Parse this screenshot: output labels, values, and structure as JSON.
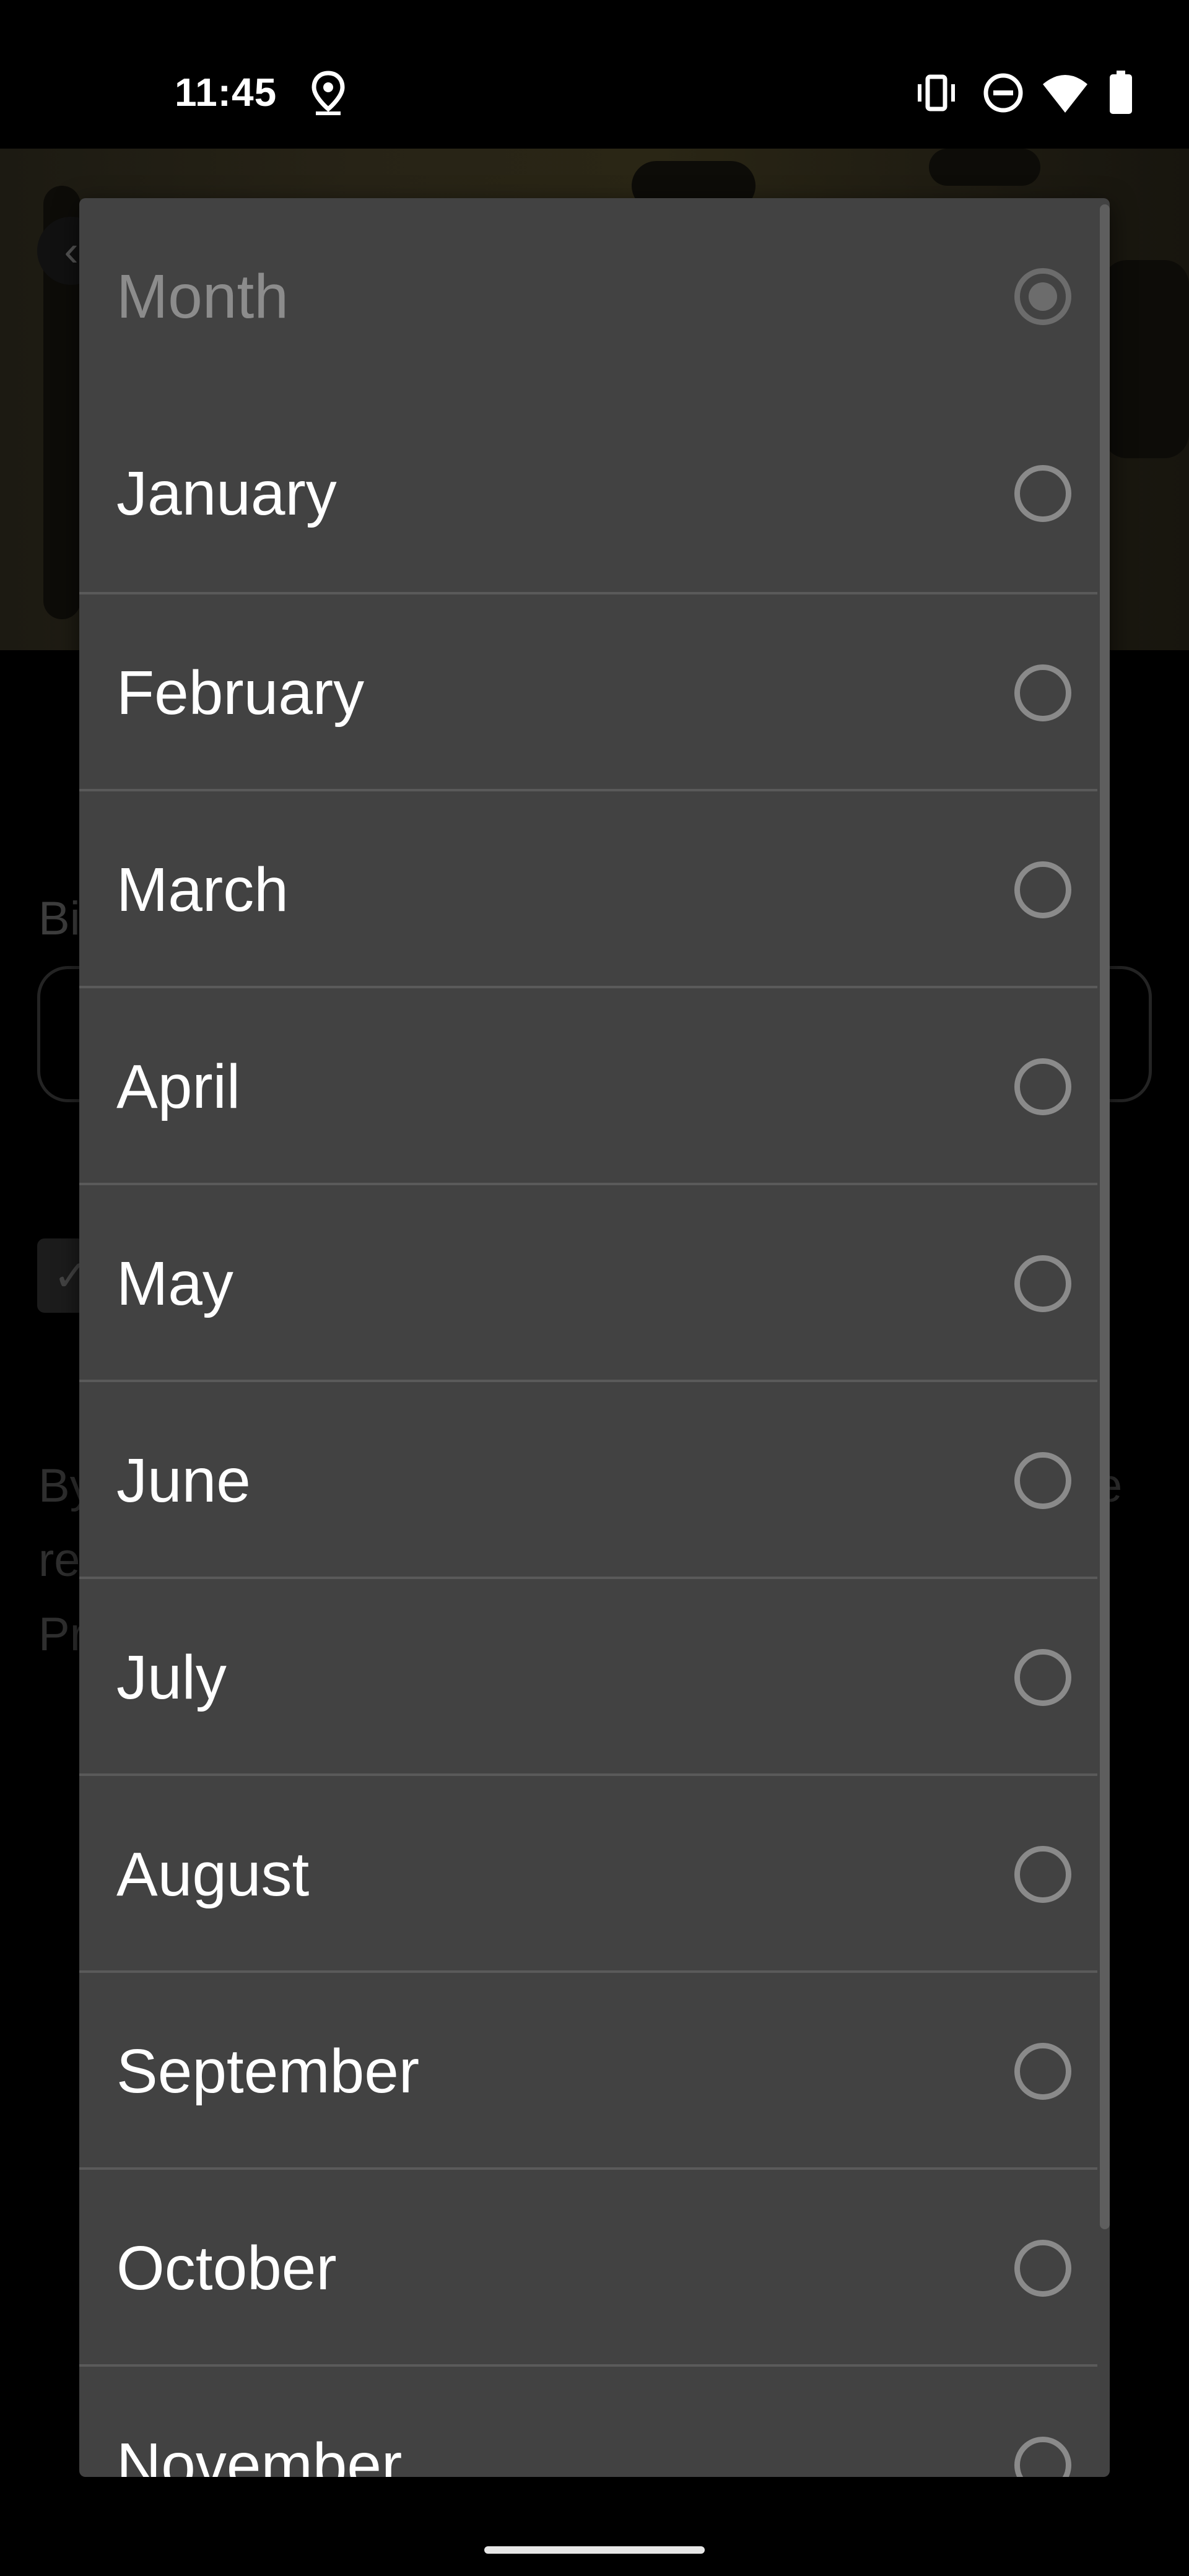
{
  "status_bar": {
    "time": "11:45",
    "icons": [
      "location-icon",
      "vibrate-icon",
      "do-not-disturb-icon",
      "wifi-icon",
      "battery-icon"
    ]
  },
  "background": {
    "field_label_fragment": "Bi",
    "terms_fragment": "By\nre\nPr",
    "terms_right_fragment": "e"
  },
  "dialog": {
    "header": {
      "label": "Month",
      "selected": true
    },
    "options": [
      {
        "label": "January"
      },
      {
        "label": "February"
      },
      {
        "label": "March"
      },
      {
        "label": "April"
      },
      {
        "label": "May"
      },
      {
        "label": "June"
      },
      {
        "label": "July"
      },
      {
        "label": "August"
      },
      {
        "label": "September"
      },
      {
        "label": "October"
      },
      {
        "label": "November"
      }
    ]
  },
  "colors": {
    "dialog_bg": "#424242",
    "divider": "#5a5a5a",
    "text": "#ffffff",
    "header_text": "#8c8c8c",
    "radio": "#8a8a8a"
  }
}
